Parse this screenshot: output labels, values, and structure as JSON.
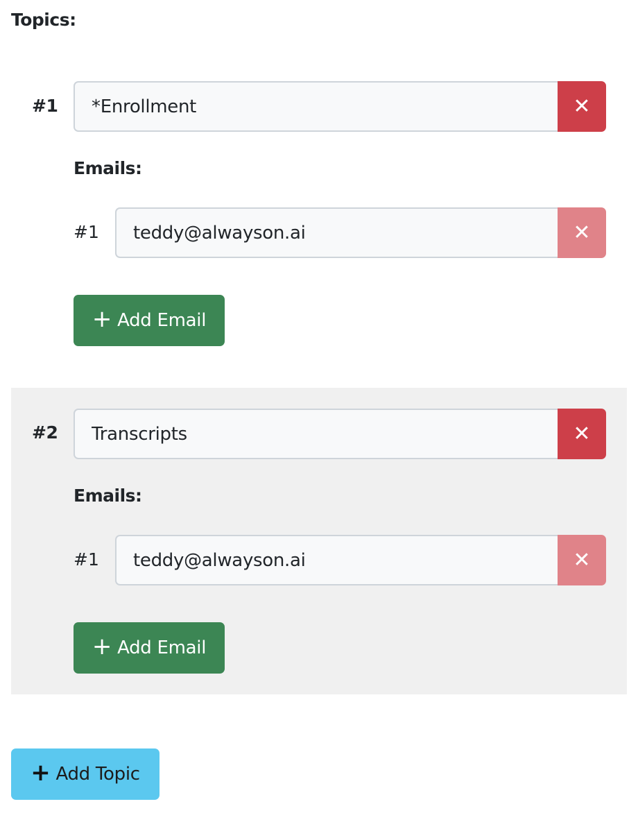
{
  "section_label": "Topics:",
  "topics": [
    {
      "index_label": "#1",
      "value": "*Enrollment",
      "emails_label": "Emails:",
      "emails": [
        {
          "index_label": "#1",
          "value": "teddy@alwayson.ai"
        }
      ],
      "add_email_label": "Add Email"
    },
    {
      "index_label": "#2",
      "value": "Transcripts",
      "emails_label": "Emails:",
      "emails": [
        {
          "index_label": "#1",
          "value": "teddy@alwayson.ai"
        }
      ],
      "add_email_label": "Add Email"
    }
  ],
  "add_topic_label": "Add Topic",
  "icons": {
    "remove": "close-icon",
    "add": "plus-icon"
  },
  "colors": {
    "remove_topic": "#cd3f49",
    "remove_email": "#e08389",
    "add_email": "#3c8654",
    "add_topic": "#5bc8ef",
    "alt_topic_background": "#f0f0f0"
  }
}
